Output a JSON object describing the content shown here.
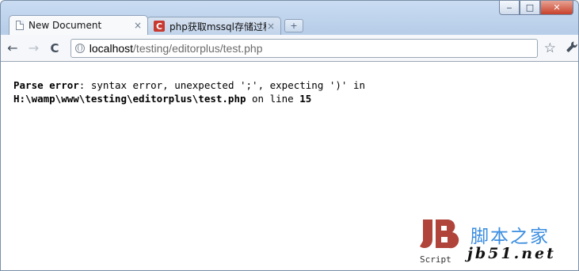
{
  "window": {
    "controls": {
      "minimize": "‒",
      "maximize": "□",
      "close": "✕"
    }
  },
  "tabs": [
    {
      "title": "New Document",
      "icon": "document-icon",
      "close": "×",
      "active": true
    },
    {
      "title": "php获取mssql存储过程...",
      "icon": "c-logo-icon",
      "close": "×",
      "active": false
    }
  ],
  "new_tab": "+",
  "toolbar": {
    "back": "←",
    "forward": "→",
    "reload": "C",
    "url_host": "localhost",
    "url_path": "/testing/editorplus/test.php",
    "star": "☆",
    "wrench": "🔧"
  },
  "page": {
    "error_label": "Parse error",
    "error_message": ": syntax error, unexpected ';', expecting ')' in",
    "error_file": "H:\\wamp\\www\\testing\\editorplus\\test.php",
    "error_on_line": " on line ",
    "error_line": "15"
  },
  "watermark": {
    "logo_text": "jB",
    "logo_sub": "Script",
    "site_cn": "脚本之家",
    "site_url": "jb51.net",
    "colors": {
      "logo": "#b0443a",
      "cn": "#3b8de0"
    }
  }
}
